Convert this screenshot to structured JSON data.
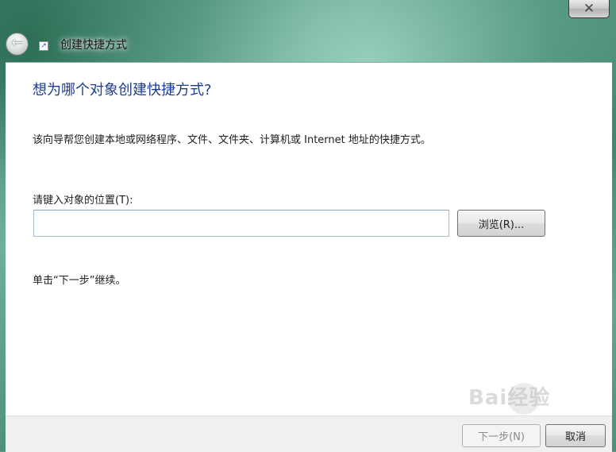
{
  "window": {
    "title": "创建快捷方式",
    "close_glyph": "✕",
    "back_glyph": "←",
    "accent_color": "#1e3d8f"
  },
  "wizard": {
    "heading": "想为哪个对象创建快捷方式?",
    "description": "该向导帮您创建本地或网络程序、文件、文件夹、计算机或 Internet 地址的快捷方式。",
    "location_label": "请键入对象的位置(T):",
    "location_value": "",
    "browse_label": "浏览(R)...",
    "hint": "单击“下一步”继续。"
  },
  "footer": {
    "next_label": "下一步(N)",
    "cancel_label": "取消"
  },
  "watermark": {
    "text": "Bai经验"
  }
}
